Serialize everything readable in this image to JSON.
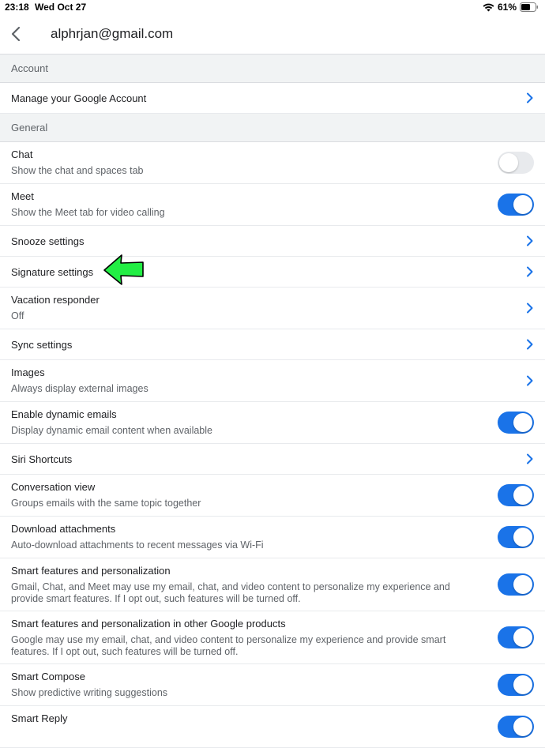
{
  "status_bar": {
    "time": "23:18",
    "date": "Wed Oct 27",
    "battery": "61%"
  },
  "header": {
    "title": "alphrjan@gmail.com"
  },
  "colors": {
    "accent": "#1a73e8",
    "section_bg": "#f1f3f4",
    "pointer_arrow": "#22ee44"
  },
  "sections": {
    "account": "Account",
    "general": "General"
  },
  "account": {
    "manage_google_account": "Manage your Google Account"
  },
  "general": {
    "chat": {
      "title": "Chat",
      "subtitle": "Show the chat and spaces tab",
      "enabled": false
    },
    "meet": {
      "title": "Meet",
      "subtitle": "Show the Meet tab for video calling",
      "enabled": true
    },
    "snooze": {
      "title": "Snooze settings"
    },
    "signature": {
      "title": "Signature settings"
    },
    "vacation": {
      "title": "Vacation responder",
      "subtitle": "Off"
    },
    "sync": {
      "title": "Sync settings"
    },
    "images": {
      "title": "Images",
      "subtitle": "Always display external images"
    },
    "dynamic": {
      "title": "Enable dynamic emails",
      "subtitle": "Display dynamic email content when available",
      "enabled": true
    },
    "siri": {
      "title": "Siri Shortcuts"
    },
    "conversation": {
      "title": "Conversation view",
      "subtitle": "Groups emails with the same topic together",
      "enabled": true
    },
    "download": {
      "title": "Download attachments",
      "subtitle": "Auto-download attachments to recent messages via Wi-Fi",
      "enabled": true
    },
    "smart_features": {
      "title": "Smart features and personalization",
      "subtitle": "Gmail, Chat, and Meet may use my email, chat, and video content to personalize my experience and provide smart features. If I opt out, such features will be turned off.",
      "enabled": true
    },
    "smart_features_other": {
      "title": "Smart features and personalization in other Google products",
      "subtitle": "Google may use my email, chat, and video content to personalize my experience and provide smart features. If I opt out, such features will be turned off.",
      "enabled": true
    },
    "smart_compose": {
      "title": "Smart Compose",
      "subtitle": "Show predictive writing suggestions",
      "enabled": true
    },
    "smart_reply": {
      "title": "Smart Reply",
      "enabled": true
    }
  }
}
